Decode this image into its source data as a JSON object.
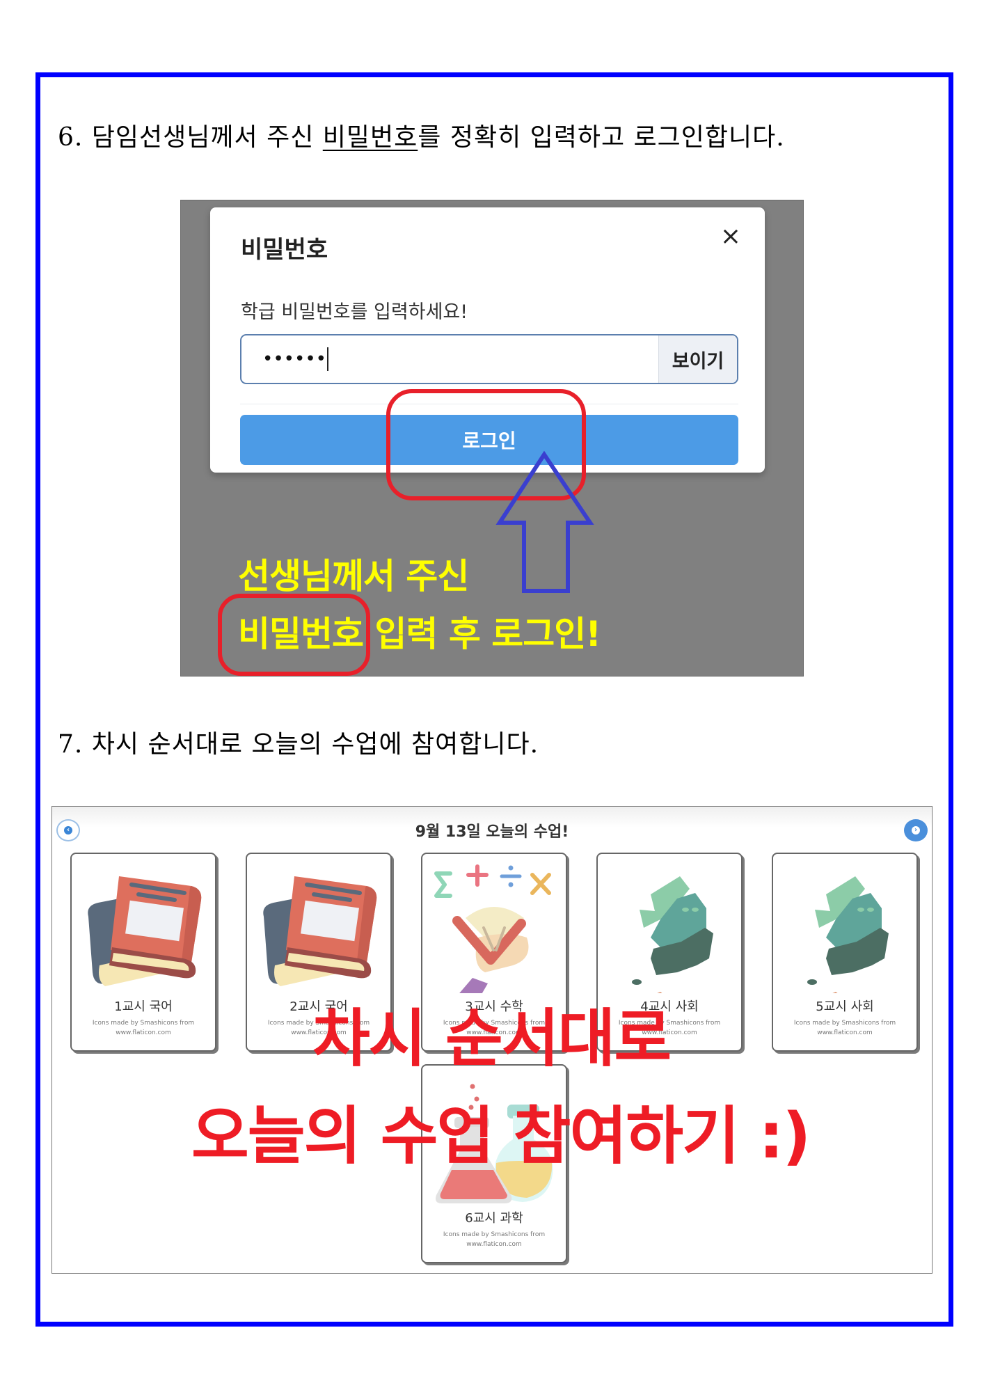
{
  "step6": {
    "number": "6.",
    "text_before": "담임선생님께서 주신 ",
    "underlined": "비밀번호",
    "text_after": "를 정확히 입력하고 로그인합니다."
  },
  "login_screenshot": {
    "modal": {
      "title": "비밀번호",
      "close_icon": "×",
      "prompt": "학급 비밀번호를 입력하세요!",
      "password_masked": "••••••",
      "show_button": "보이기",
      "login_button": "로그인"
    },
    "annotation": {
      "line1": "선생님께서 주신",
      "line2_highlight": "비밀번호",
      "line2_rest": " 입력 후 로그인!",
      "highlight_color": "#e8202a",
      "arrow_color": "#3a3fcf",
      "text_color": "#ffff00"
    }
  },
  "step7": {
    "number": "7.",
    "text": "차시 순서대로 오늘의 수업에 참여합니다."
  },
  "lesson_screenshot": {
    "title": "9월 13일 오늘의 수업!",
    "prev_icon": "‹",
    "next_icon": "›",
    "cards": [
      {
        "label": "1교시 국어",
        "icon": "book-icon",
        "credit1": "Icons made by Smashicons from",
        "credit2": "www.flaticon.com"
      },
      {
        "label": "2교시 국어",
        "icon": "book-icon",
        "credit1": "Icons made by Smashicons from",
        "credit2": "www.flaticon.com"
      },
      {
        "label": "3교시 수학",
        "icon": "math-icon",
        "credit1": "Icons made by Smashicons from",
        "credit2": "www.flaticon.com"
      },
      {
        "label": "4교시 사회",
        "icon": "korea-map-icon",
        "credit1": "Icons made by Smashicons from",
        "credit2": "www.flaticon.com"
      },
      {
        "label": "5교시 사회",
        "icon": "korea-map-icon",
        "credit1": "Icons made by Smashicons from",
        "credit2": "www.flaticon.com"
      },
      {
        "label": "6교시 과학",
        "icon": "flask-icon",
        "credit1": "Icons made by Smashicons from",
        "credit2": "www.flaticon.com"
      }
    ],
    "overlay": {
      "line1": "차시 순서대로",
      "line2": "오늘의 수업 참여하기 :)",
      "color": "#ee1c25"
    }
  }
}
